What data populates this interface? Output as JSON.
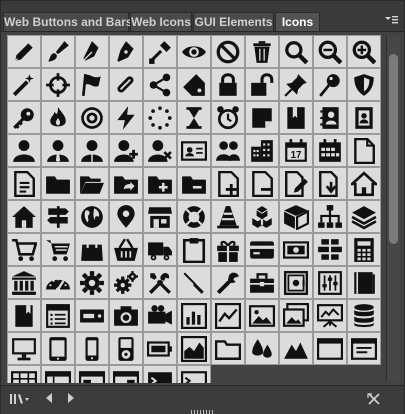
{
  "tabs": [
    {
      "label": "Web Buttons and Bars",
      "active": false
    },
    {
      "label": "Web Icons",
      "active": false
    },
    {
      "label": "GUI Elements",
      "active": false
    },
    {
      "label": "Icons",
      "active": true
    }
  ],
  "icons": [
    "pencil",
    "paintbrush",
    "fountain-pen",
    "fountain-pen-nib",
    "paint-roller",
    "eye",
    "prohibited",
    "trash",
    "magnifier",
    "zoom-out",
    "zoom-in",
    "magic-wand",
    "crosshair",
    "flag",
    "paperclip",
    "share",
    "tag",
    "padlock-closed",
    "padlock-open",
    "pushpin",
    "pin",
    "shield",
    "key",
    "flame",
    "target",
    "lightning",
    "loading-dots",
    "hourglass",
    "alarm-clock",
    "sticky-note",
    "bookmark-book",
    "contacts-book",
    "contacts-book-2",
    "user",
    "user-tie",
    "user-pin",
    "user-add",
    "user-remove",
    "id-card",
    "users-group",
    "buildings",
    "calendar-17",
    "calendar",
    "document",
    "document-text",
    "folder",
    "folder-open",
    "folder-share",
    "folder-add",
    "folder-remove",
    "document-add",
    "document-remove",
    "document-edit",
    "document-download",
    "home",
    "home-2",
    "signpost",
    "globe",
    "map-marker",
    "store",
    "lifebuoy",
    "traffic-cone",
    "cubes",
    "box",
    "hierarchy",
    "layers",
    "shopping-cart",
    "shopping-cart-2",
    "shopping-bag",
    "basket",
    "truck",
    "clipboard",
    "gift",
    "credit-card",
    "banknote",
    "bricks",
    "calculator",
    "bank",
    "dashboard",
    "gear",
    "gears",
    "tools",
    "screwdriver",
    "wrench",
    "toolbox",
    "safe",
    "mixer",
    "book",
    "book-closed",
    "notebook",
    "hard-drive",
    "camera",
    "projector",
    "chart-box",
    "chart-line",
    "picture",
    "pictures",
    "presentation",
    "database",
    "monitor",
    "tablet",
    "phone",
    "ipod",
    "battery",
    "chart-area",
    "folder-alt",
    "drops",
    "mountains",
    "window",
    "window-2",
    "grid-box",
    "grid-box-2",
    "window-3",
    "window-4",
    "terminal",
    "terminal-2"
  ],
  "bottom_bar": {
    "library_icon": "library-icon",
    "prev_icon": "prev-icon",
    "next_icon": "next-icon",
    "delete_icon": "delete-icon"
  }
}
